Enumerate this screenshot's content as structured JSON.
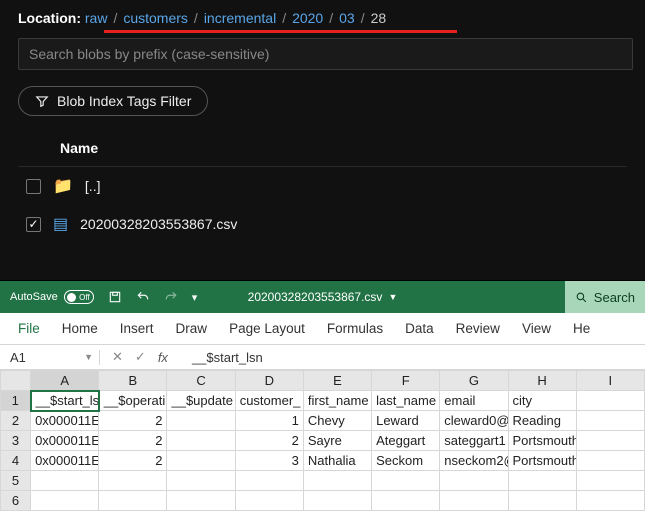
{
  "blob": {
    "location_label": "Location:",
    "crumbs": [
      "raw",
      "customers",
      "incremental",
      "2020",
      "03",
      "28"
    ],
    "search_placeholder": "Search blobs by prefix (case-sensitive)",
    "tag_filter_label": "Blob Index Tags Filter",
    "name_header": "Name",
    "rows": [
      {
        "icon": "folder",
        "label": "[..]",
        "checked": false
      },
      {
        "icon": "file",
        "label": "20200328203553867.csv",
        "checked": true
      }
    ]
  },
  "excel": {
    "autosave_label": "AutoSave",
    "autosave_state": "Off",
    "filename": "20200328203553867.csv",
    "search_label": "Search",
    "ribbon": [
      "File",
      "Home",
      "Insert",
      "Draw",
      "Page Layout",
      "Formulas",
      "Data",
      "Review",
      "View",
      "He"
    ],
    "namebox": "A1",
    "formula_bar": "__$start_lsn",
    "columns": [
      "A",
      "B",
      "C",
      "D",
      "E",
      "F",
      "G",
      "H",
      "I"
    ],
    "rows": [
      [
        "__$start_lsn",
        "__$operati",
        "__$update",
        "customer_",
        "first_name",
        "last_name",
        "email",
        "city",
        ""
      ],
      [
        "0x000011E",
        "2",
        "",
        "1",
        "Chevy",
        "Leward",
        "cleward0@",
        "Reading",
        ""
      ],
      [
        "0x000011E",
        "2",
        "",
        "2",
        "Sayre",
        "Ateggart",
        "sateggart1",
        "Portsmouth",
        ""
      ],
      [
        "0x000011E",
        "2",
        "",
        "3",
        "Nathalia",
        "Seckom",
        "nseckom2@",
        "Portsmouth",
        ""
      ],
      [
        "",
        "",
        "",
        "",
        "",
        "",
        "",
        "",
        ""
      ],
      [
        "",
        "",
        "",
        "",
        "",
        "",
        "",
        "",
        ""
      ]
    ],
    "numeric_cols": [
      1,
      3
    ]
  }
}
